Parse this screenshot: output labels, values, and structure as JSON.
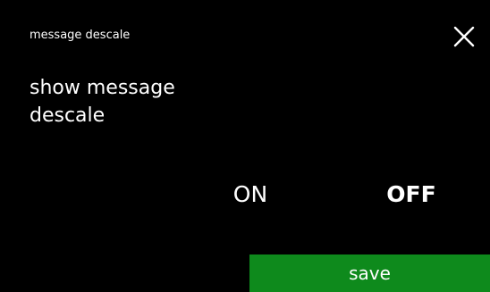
{
  "header": {
    "title": "message descale",
    "close_icon": "close-icon"
  },
  "setting": {
    "label": "show message descale"
  },
  "toggle": {
    "on_label": "ON",
    "off_label": "OFF",
    "selected": "OFF"
  },
  "footer": {
    "save_label": "save"
  },
  "colors": {
    "background": "#000000",
    "text": "#ffffff",
    "save_button": "#0e8a1c"
  }
}
